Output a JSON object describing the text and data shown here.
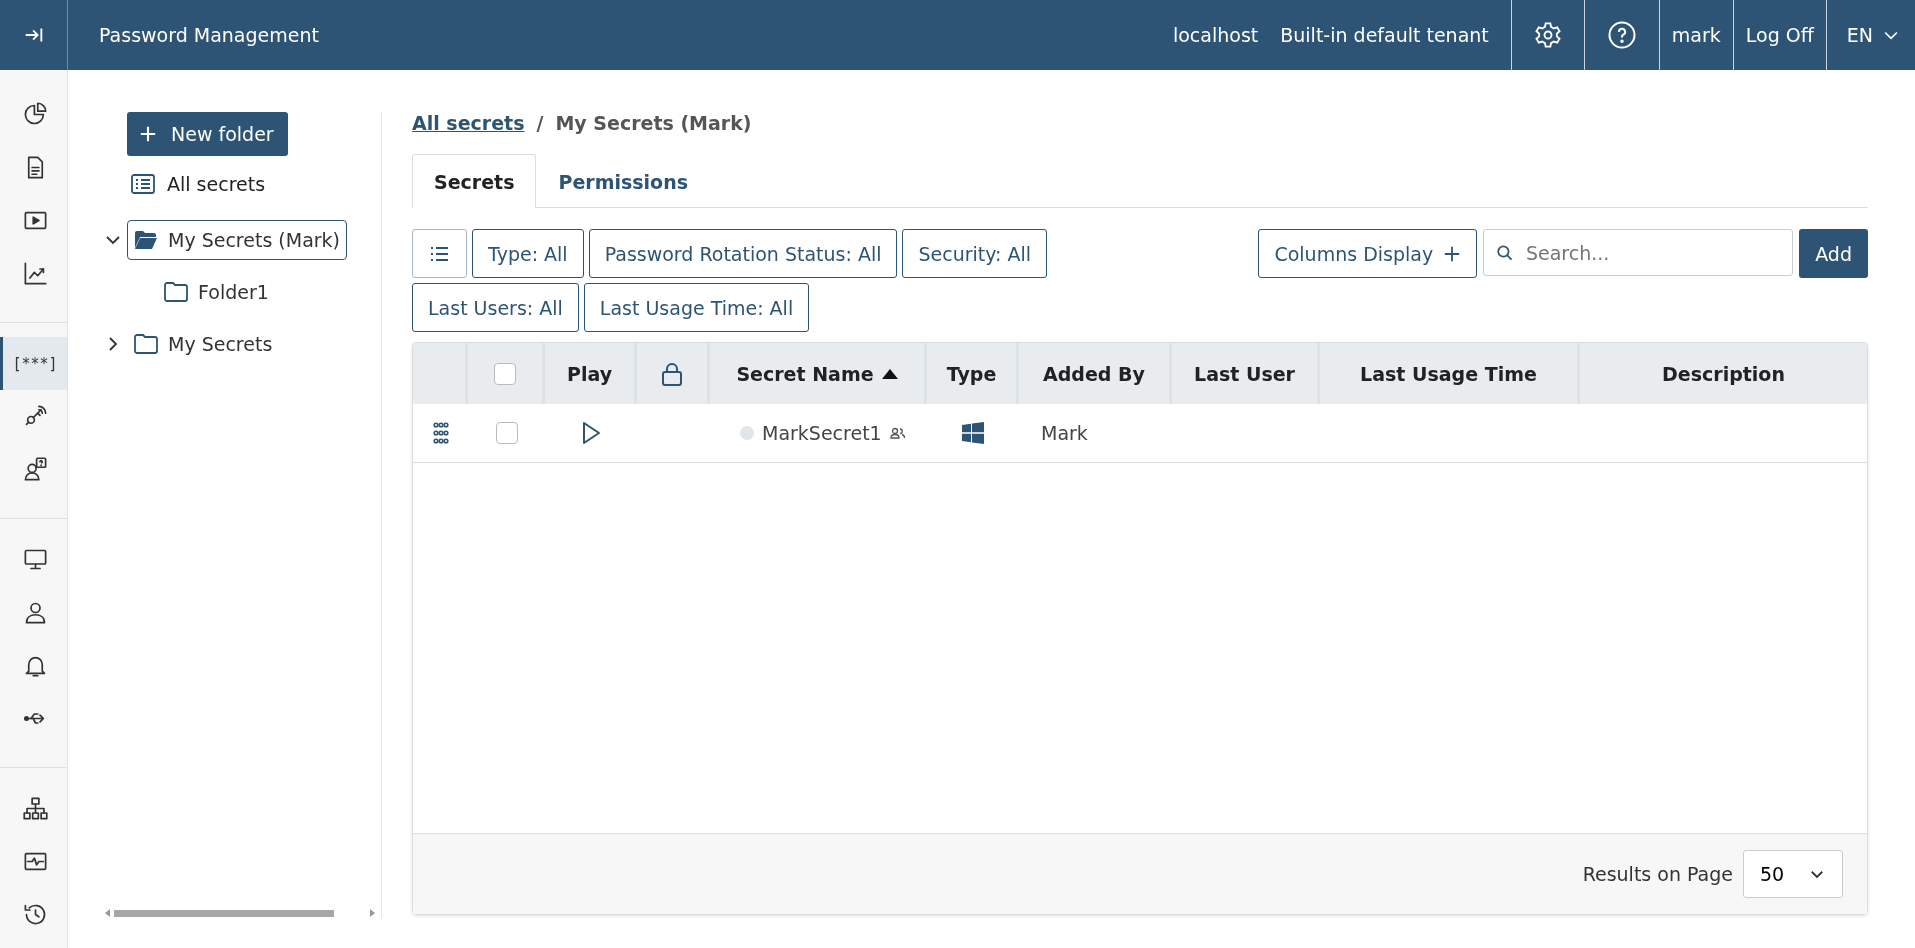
{
  "app_bar": {
    "title": "Password Management",
    "host": "localhost",
    "tenant": "Built-in default tenant",
    "user": "mark",
    "log_off": "Log Off",
    "language": "EN"
  },
  "rail": [
    [
      {
        "selected": false
      },
      {
        "selected": false
      },
      {
        "selected": false
      },
      {
        "selected": false
      }
    ],
    [
      {
        "label": "[***]",
        "selected": true
      },
      {
        "selected": false
      },
      {
        "selected": false
      }
    ],
    [
      {
        "selected": false
      },
      {
        "selected": false
      },
      {
        "selected": false
      },
      {
        "selected": false
      }
    ],
    [
      {
        "selected": false
      },
      {
        "selected": false
      },
      {
        "selected": false
      }
    ]
  ],
  "folders": {
    "new_folder": "New folder",
    "all_secrets": "All secrets",
    "tree": [
      {
        "label": "My Secrets (Mark)",
        "expanded": true,
        "selected": true,
        "children": [
          {
            "label": "Folder1",
            "selected": false
          }
        ]
      },
      {
        "label": "My Secrets",
        "expanded": false,
        "selected": false
      }
    ]
  },
  "breadcrumb": {
    "link": "All secrets",
    "separator": "/",
    "current": "My Secrets (Mark)"
  },
  "tabs": [
    {
      "label": "Secrets",
      "selected": true
    },
    {
      "label": "Permissions",
      "selected": false
    }
  ],
  "filters": [
    "Type: All",
    "Password Rotation Status: All",
    "Security: All",
    "Last Users: All",
    "Last Usage Time: All"
  ],
  "columns_display": "Columns Display",
  "search": {
    "placeholder": "Search..."
  },
  "add": "Add",
  "table": {
    "columns": [
      {
        "label": "Play",
        "sorted": false
      },
      {
        "label": "Secret Name",
        "sorted": true
      },
      {
        "label": "Type",
        "sorted": false
      },
      {
        "label": "Added By",
        "sorted": false
      },
      {
        "label": "Last User",
        "sorted": false
      },
      {
        "label": "Last Usage Time",
        "sorted": false
      },
      {
        "label": "Description",
        "sorted": false
      }
    ],
    "all_checked": false,
    "rows": [
      {
        "checked": false,
        "name": "MarkSecret1",
        "added_by": "Mark"
      }
    ]
  },
  "footer": {
    "label": "Results on Page",
    "page_size": "50"
  }
}
